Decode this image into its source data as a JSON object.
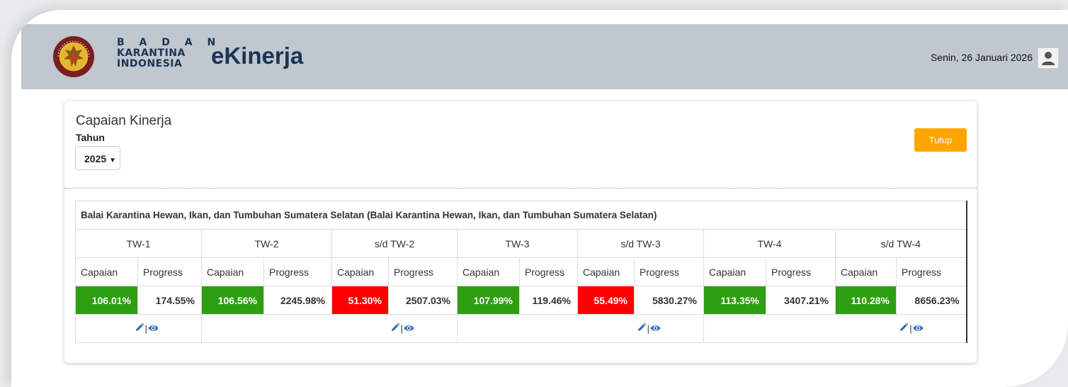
{
  "header": {
    "logo_text": "BADAN KARANTINA INDONESIA",
    "brand_line1": "B A D A N",
    "brand_line2": "KARANTINA",
    "brand_line3": "INDONESIA",
    "app_title": "eKinerja",
    "date": "Senin, 26 Januari 2026"
  },
  "card": {
    "title": "Capaian Kinerja",
    "tahun_label": "Tahun",
    "year_selected": "2025",
    "close_label": "Tutup"
  },
  "table": {
    "unit_title": "Balai Karantina Hewan, Ikan, dan Tumbuhan Sumatera Selatan (Balai Karantina Hewan, Ikan, dan Tumbuhan Sumatera Selatan)",
    "periods": [
      "TW-1",
      "TW-2",
      "s/d TW-2",
      "TW-3",
      "s/d TW-3",
      "TW-4",
      "s/d TW-4"
    ],
    "capaian_label": "Capaian",
    "progress_label": "Progress",
    "rows": [
      {
        "capaian": "106.01%",
        "progress": "174.55%",
        "status": "green"
      },
      {
        "capaian": "106.56%",
        "progress": "2245.98%",
        "status": "green"
      },
      {
        "capaian": "51.30%",
        "progress": "2507.03%",
        "status": "red"
      },
      {
        "capaian": "107.99%",
        "progress": "119.46%",
        "status": "green"
      },
      {
        "capaian": "55.49%",
        "progress": "5830.27%",
        "status": "red"
      },
      {
        "capaian": "113.35%",
        "progress": "3407.21%",
        "status": "green"
      },
      {
        "capaian": "110.28%",
        "progress": "8656.23%",
        "status": "green"
      }
    ],
    "action_separator": "|",
    "colors": {
      "green": "#2e9e12",
      "red": "#ff0000",
      "icon": "#2a6db5"
    }
  }
}
